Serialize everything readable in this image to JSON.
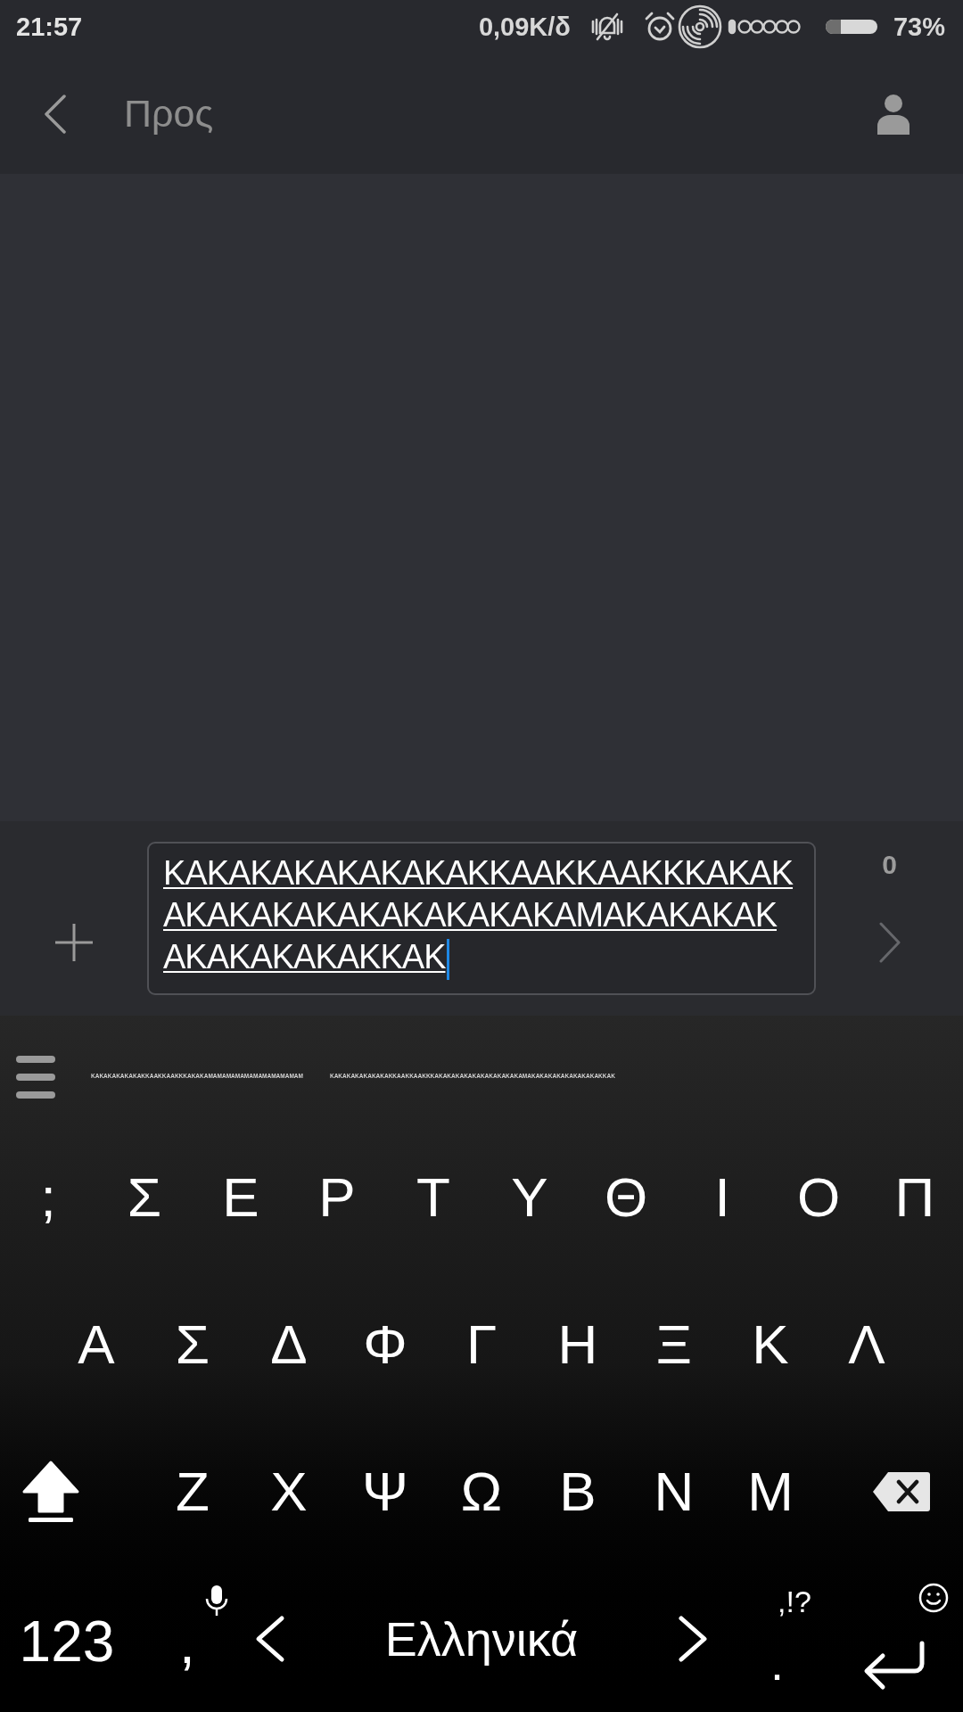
{
  "status_bar": {
    "time": "21:57",
    "network_speed": "0,09K/δ",
    "battery": "73%"
  },
  "header": {
    "recipient": {
      "placeholder": "Προς"
    }
  },
  "compose": {
    "message_lines": [
      "ΚΑΚΑΚΑΚΑΚΑΚΑΚΑΚΚΑΑΚΚΑΑΚΚΚΑΚΑΚ",
      "ΑΚΑΚΑΚΑΚΑΚΑΚΑΚΑΚΑΚΑΜΑΚΑΚΑΚΑΚ",
      "ΑΚΑΚΑΚΑΚΑΚΚΑΚ"
    ],
    "counter": "0"
  },
  "keyboard": {
    "suggestions": [
      "ΚΑΚΑΚΑΚΑΚΑΚΑΚΚΑΑΚΚΑΑΚΚΚΑΚΑΚΑΜΑΜΑΜΑΜΑΜΑΜΑΜΑΜΑΜΑΜΑΜ",
      "ΚΑΚΑΚΑΚΑΚΑΚΑΚΑΚΚΑΑΚΚΑΑΚΚΚΑΚΑΚΑΚΑΚΑΚΑΚΑΚΑΚΑΚΑΚΑΜΑΚΑΚΑΚΑΚΑΚΑΚΑΚΑΚΑΚΚΑΚ"
    ],
    "rows": [
      {
        "kind": "full",
        "keys": [
          ";",
          "Σ",
          "Ε",
          "Ρ",
          "Τ",
          "Υ",
          "Θ",
          "Ι",
          "Ο",
          "Π"
        ]
      },
      {
        "kind": "inset",
        "keys": [
          "Α",
          "Σ",
          "Δ",
          "Φ",
          "Γ",
          "Η",
          "Ξ",
          "Κ",
          "Λ"
        ]
      },
      {
        "kind": "modifiers",
        "shift_on": true,
        "keys": [
          "Ζ",
          "Χ",
          "Ψ",
          "Ω",
          "Β",
          "Ν",
          "Μ"
        ]
      }
    ],
    "bottom_row": [
      {
        "kind": "text",
        "label": "123"
      },
      {
        "kind": "voice_hint",
        "label": ","
      },
      {
        "kind": "space",
        "label": "Ελληνικά"
      },
      {
        "kind": "hint",
        "label": ".",
        "hint": ",!?"
      },
      {
        "kind": "enter"
      }
    ]
  }
}
